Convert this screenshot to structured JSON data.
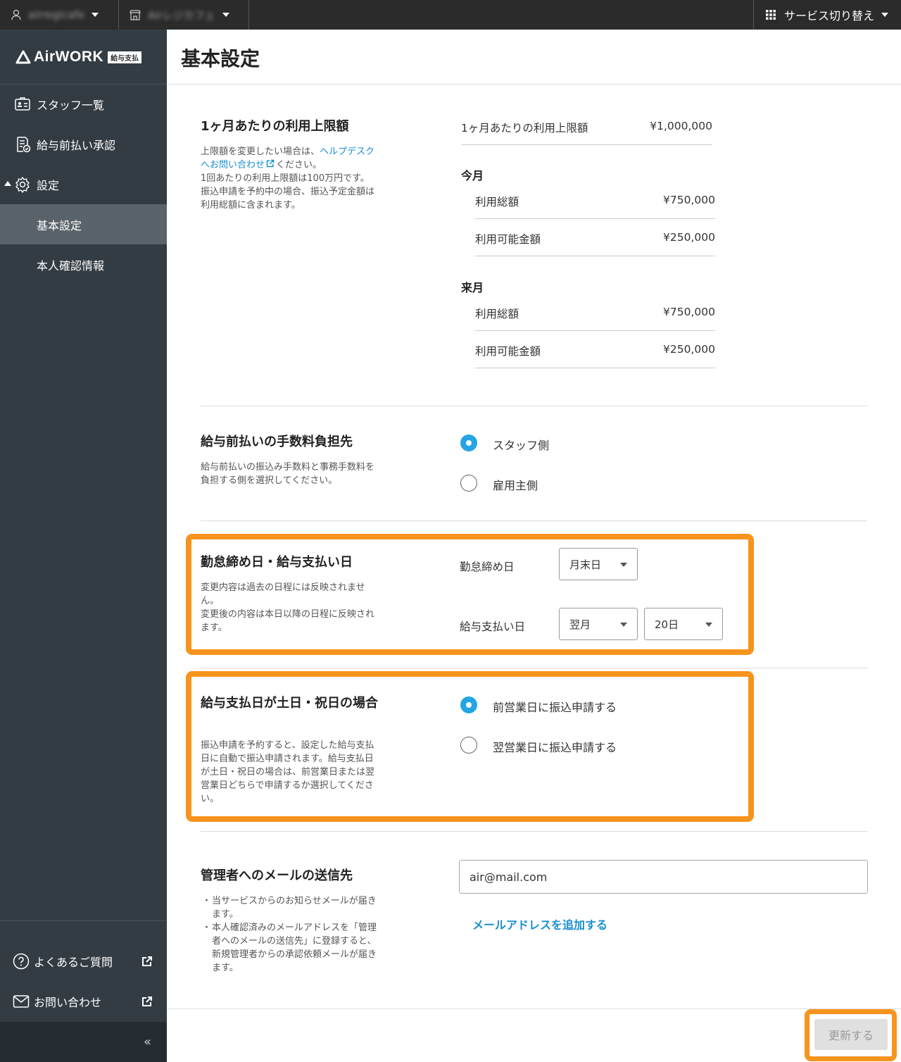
{
  "topbar": {
    "account": "airregicafe",
    "store": "Airレジカフェ",
    "service_switch": "サービス切り替え"
  },
  "sidebar": {
    "logo_text": "AirWORK",
    "logo_badge": "給与支払",
    "items": [
      {
        "label": "スタッフ一覧",
        "icon": "staff-card-icon"
      },
      {
        "label": "給与前払い承認",
        "icon": "approval-doc-icon"
      },
      {
        "label": "設定",
        "icon": "gear-icon"
      },
      {
        "label": "基本設定"
      },
      {
        "label": "本人確認情報"
      }
    ],
    "faq": "よくあるご質問",
    "contact": "お問い合わせ",
    "collapse": "«"
  },
  "page": {
    "title": "基本設定"
  },
  "limit": {
    "title": "1ヶ月あたりの利用上限額",
    "desc_pre": "上限額を変更したい場合は、",
    "desc_link": "ヘルプデスクへお問い合わせ",
    "desc_post": "ください。",
    "desc2": "1回あたりの利用上限額は100万円です。振込申請を予約中の場合、振込予定金額は利用総額に含まれます。",
    "monthly_label": "1ヶ月あたりの利用上限額",
    "monthly_value": "¥1,000,000",
    "this_month": "今月",
    "next_month": "来月",
    "rows_this": [
      {
        "label": "利用総額",
        "value": "¥750,000"
      },
      {
        "label": "利用可能金額",
        "value": "¥250,000"
      }
    ],
    "rows_next": [
      {
        "label": "利用総額",
        "value": "¥750,000"
      },
      {
        "label": "利用可能金額",
        "value": "¥250,000"
      }
    ]
  },
  "fee": {
    "title": "給与前払いの手数料負担先",
    "desc": "給与前払いの振込み手数料と事務手数料を負担する側を選択してください。",
    "options": [
      "スタッフ側",
      "雇用主側"
    ],
    "selected": 0
  },
  "closing": {
    "title": "勤怠締め日・給与支払い日",
    "desc1": "変更内容は過去の日程には反映されません。",
    "desc2": "変更後の内容は本日以降の日程に反映されます。",
    "closing_label": "勤怠締め日",
    "closing_value": "月末日",
    "pay_label": "給与支払い日",
    "pay_month": "翌月",
    "pay_day": "20日"
  },
  "holiday": {
    "title": "給与支払日が土日・祝日の場合",
    "desc": "振込申請を予約すると、設定した給与支払日に自動で振込申請されます。給与支払日が土日・祝日の場合は、前営業日または翌営業日どちらで申請するか選択してください。",
    "options": [
      "前営業日に振込申請する",
      "翌営業日に振込申請する"
    ],
    "selected": 0
  },
  "mail": {
    "title": "管理者へのメールの送信先",
    "bullet1": "当サービスからのお知らせメールが届きます。",
    "bullet2": "本人確認済みのメールアドレスを「管理者へのメールの送信先」に登録すると、新規管理者からの承認依頼メールが届きます。",
    "email": "air@mail.com",
    "add_link": "メールアドレスを追加する"
  },
  "footer": {
    "update_button": "更新する"
  },
  "colors": {
    "accent": "#23a6e3",
    "highlight": "#f7941d",
    "sidebar": "#333c43",
    "topbar": "#2b2b2b"
  }
}
